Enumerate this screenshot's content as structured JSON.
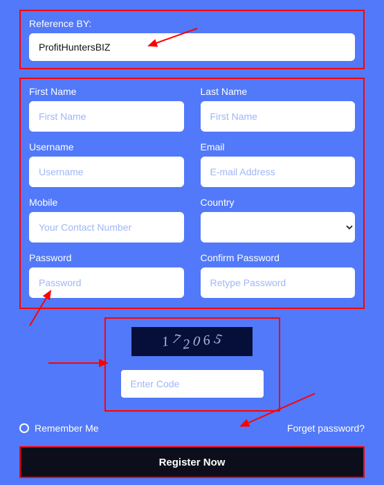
{
  "reference": {
    "label": "Reference BY:",
    "value": "ProfitHuntersBIZ"
  },
  "fields": {
    "firstName": {
      "label": "First Name",
      "placeholder": "First Name"
    },
    "lastName": {
      "label": "Last Name",
      "placeholder": "First Name"
    },
    "username": {
      "label": "Username",
      "placeholder": "Username"
    },
    "email": {
      "label": "Email",
      "placeholder": "E-mail Address"
    },
    "mobile": {
      "label": "Mobile",
      "placeholder": "Your Contact Number"
    },
    "country": {
      "label": "Country"
    },
    "password": {
      "label": "Password",
      "placeholder": "Password"
    },
    "confirmPassword": {
      "label": "Confirm Password",
      "placeholder": "Retype Password"
    }
  },
  "captcha": {
    "code": "172065",
    "placeholder": "Enter Code"
  },
  "rememberMe": "Remember Me",
  "forgetPassword": "Forget password?",
  "registerButton": "Register Now"
}
